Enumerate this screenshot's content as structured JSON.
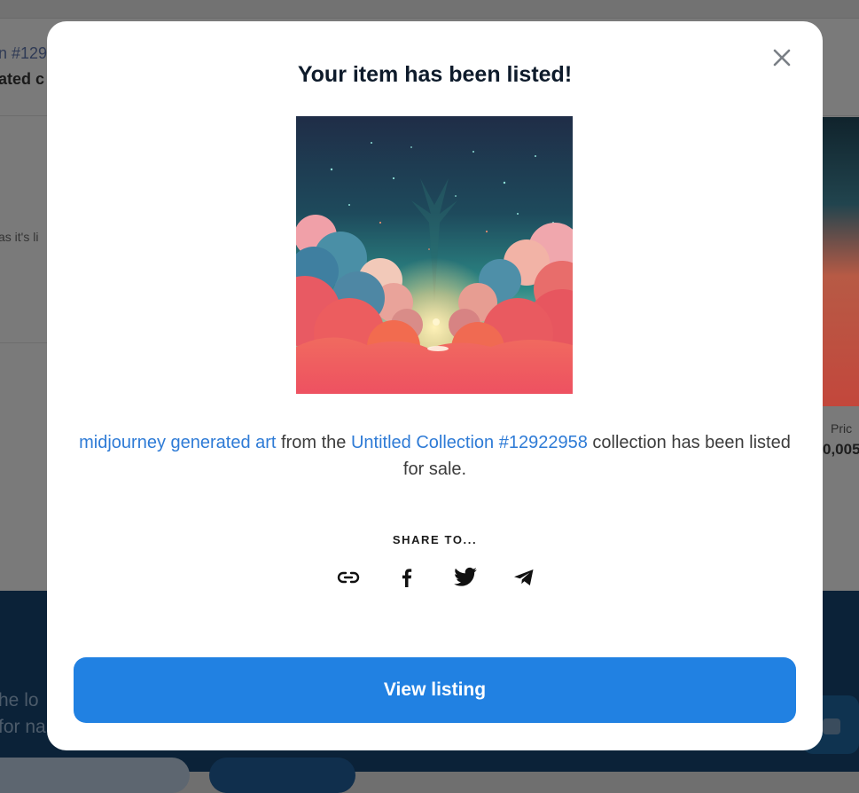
{
  "background": {
    "fragments": [
      {
        "text": "n #1292"
      },
      {
        "text": "ated c"
      },
      {
        "text": "as it's li"
      },
      {
        "text": "Pric"
      },
      {
        "text": "0,005"
      },
      {
        "text": "he lo"
      },
      {
        "text": "for na"
      }
    ]
  },
  "modal": {
    "title": "Your item has been listed!",
    "close_icon": "close-icon",
    "description": {
      "item_name": "midjourney generated art",
      "from_text": " from the ",
      "collection_name": "Untitled Collection #12922958",
      "suffix_text": " collection has been listed for sale."
    },
    "share_label": "SHARE TO...",
    "share_icons": [
      "link-icon",
      "facebook-icon",
      "twitter-icon",
      "telegram-icon"
    ],
    "view_button_label": "View listing",
    "colors": {
      "accent": "#2181e2",
      "link": "#2e7bd6",
      "title": "#0e1b2b"
    }
  }
}
